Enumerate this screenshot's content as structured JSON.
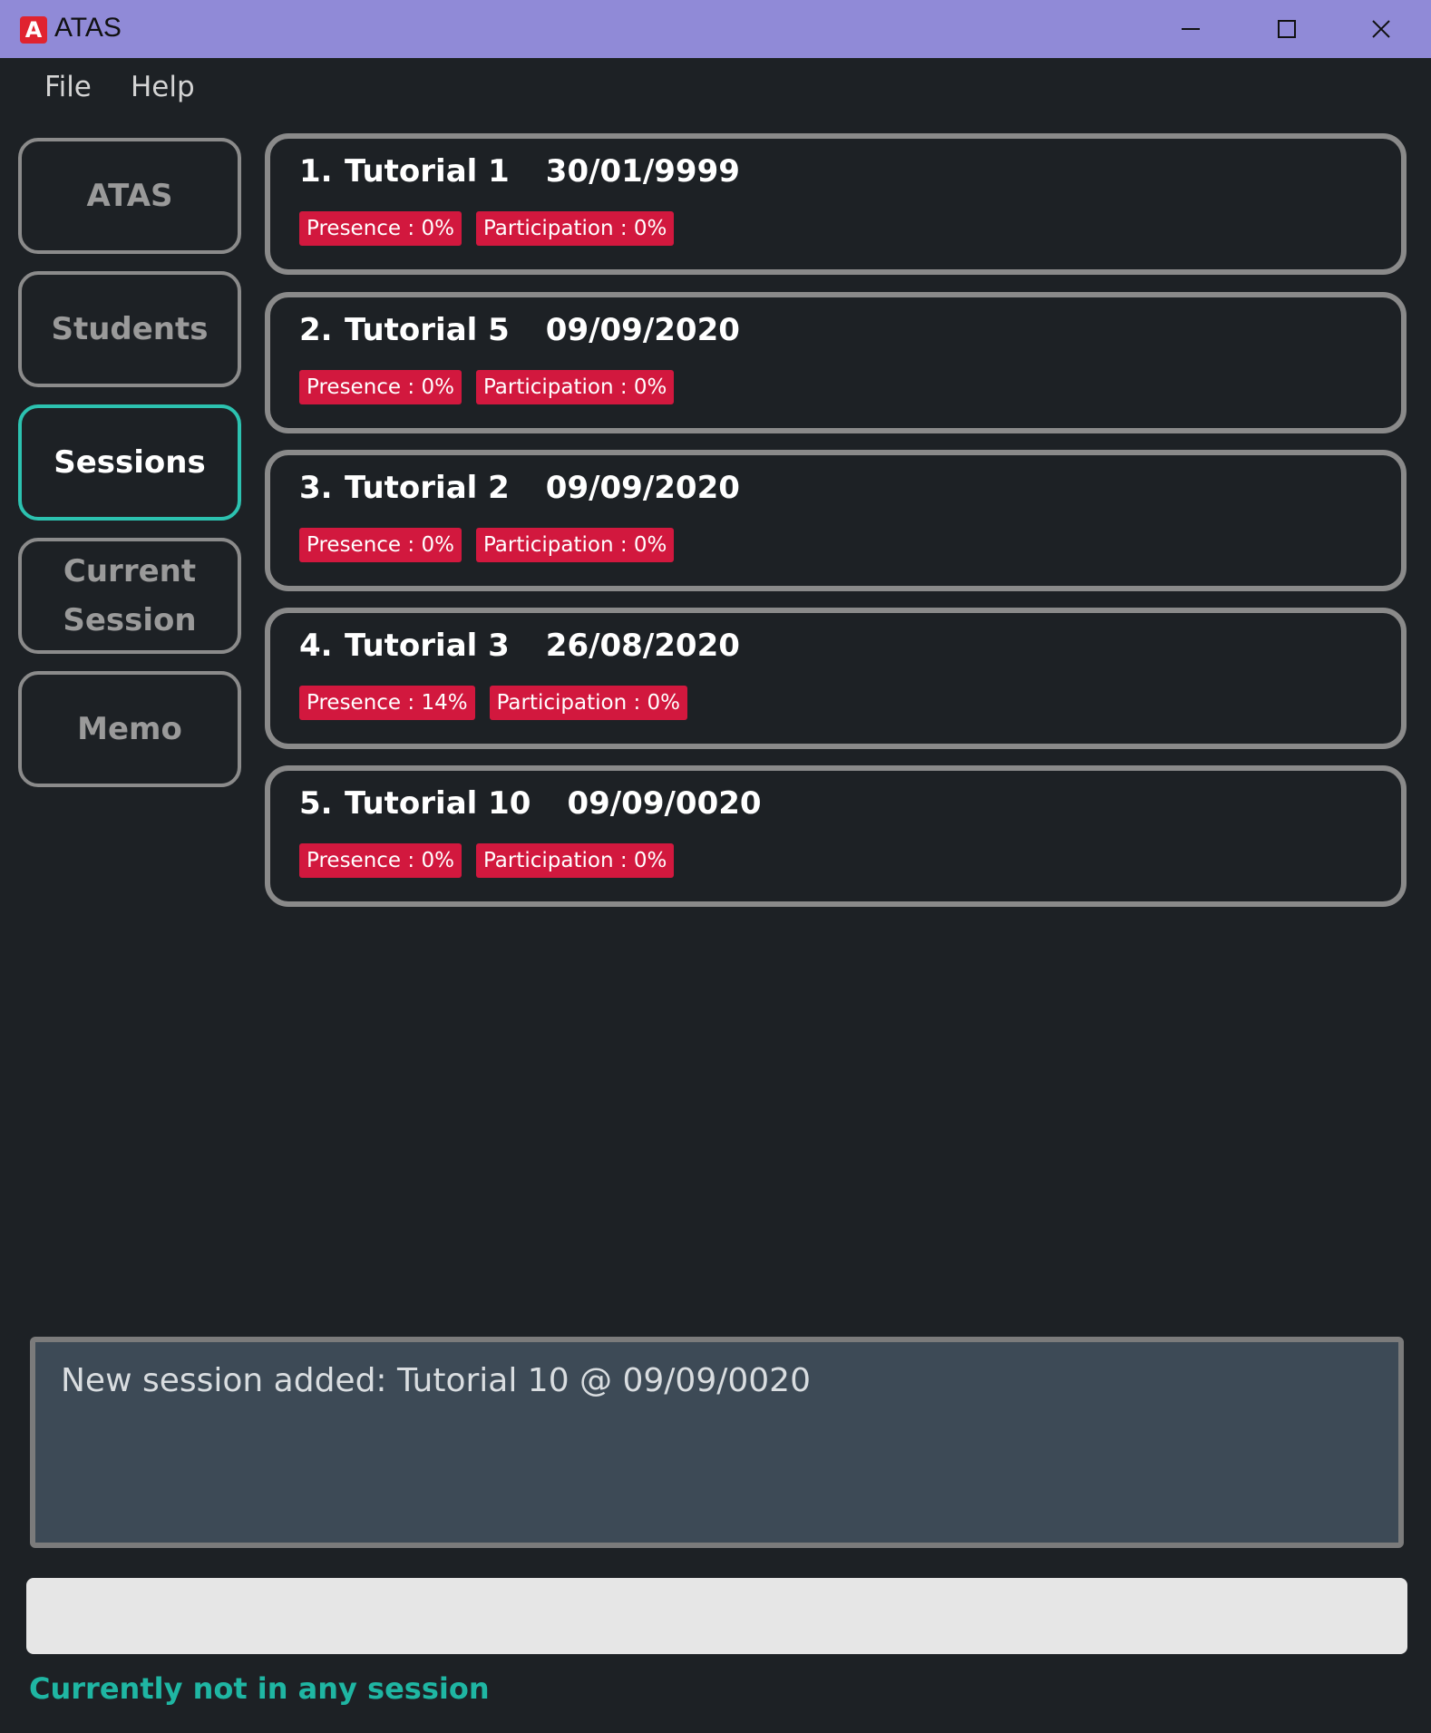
{
  "window": {
    "title": "ATAS",
    "icon_letter": "A",
    "controls": [
      "minimize-icon",
      "maximize-icon",
      "close-icon"
    ]
  },
  "menu": {
    "file": "File",
    "help": "Help"
  },
  "sidebar": {
    "items": [
      {
        "label": "ATAS",
        "active": false
      },
      {
        "label": "Students",
        "active": false
      },
      {
        "label": "Sessions",
        "active": true
      },
      {
        "label": "Current Session",
        "active": false
      },
      {
        "label": "Memo",
        "active": false
      }
    ]
  },
  "sessions": [
    {
      "index": "1.",
      "name": "Tutorial 1",
      "date": "30/01/9999",
      "presence": "Presence : 0%",
      "participation": "Participation : 0%"
    },
    {
      "index": "2.",
      "name": "Tutorial 5",
      "date": "09/09/2020",
      "presence": "Presence : 0%",
      "participation": "Participation : 0%"
    },
    {
      "index": "3.",
      "name": "Tutorial 2",
      "date": "09/09/2020",
      "presence": "Presence : 0%",
      "participation": "Participation : 0%"
    },
    {
      "index": "4.",
      "name": "Tutorial 3",
      "date": "26/08/2020",
      "presence": "Presence : 14%",
      "participation": "Participation : 0%"
    },
    {
      "index": "5.",
      "name": "Tutorial 10",
      "date": "09/09/0020",
      "presence": "Presence : 0%",
      "participation": "Participation : 0%"
    }
  ],
  "result": {
    "message": "New session added: Tutorial 10 @ 09/09/0020"
  },
  "command": {
    "value": "",
    "placeholder": ""
  },
  "status": {
    "text": "Currently not in any session"
  },
  "colors": {
    "titlebar": "#908ad7",
    "background": "#1d2125",
    "active_accent": "#2cc2b0",
    "tag": "#d2183e",
    "status": "#1fb6a3"
  }
}
